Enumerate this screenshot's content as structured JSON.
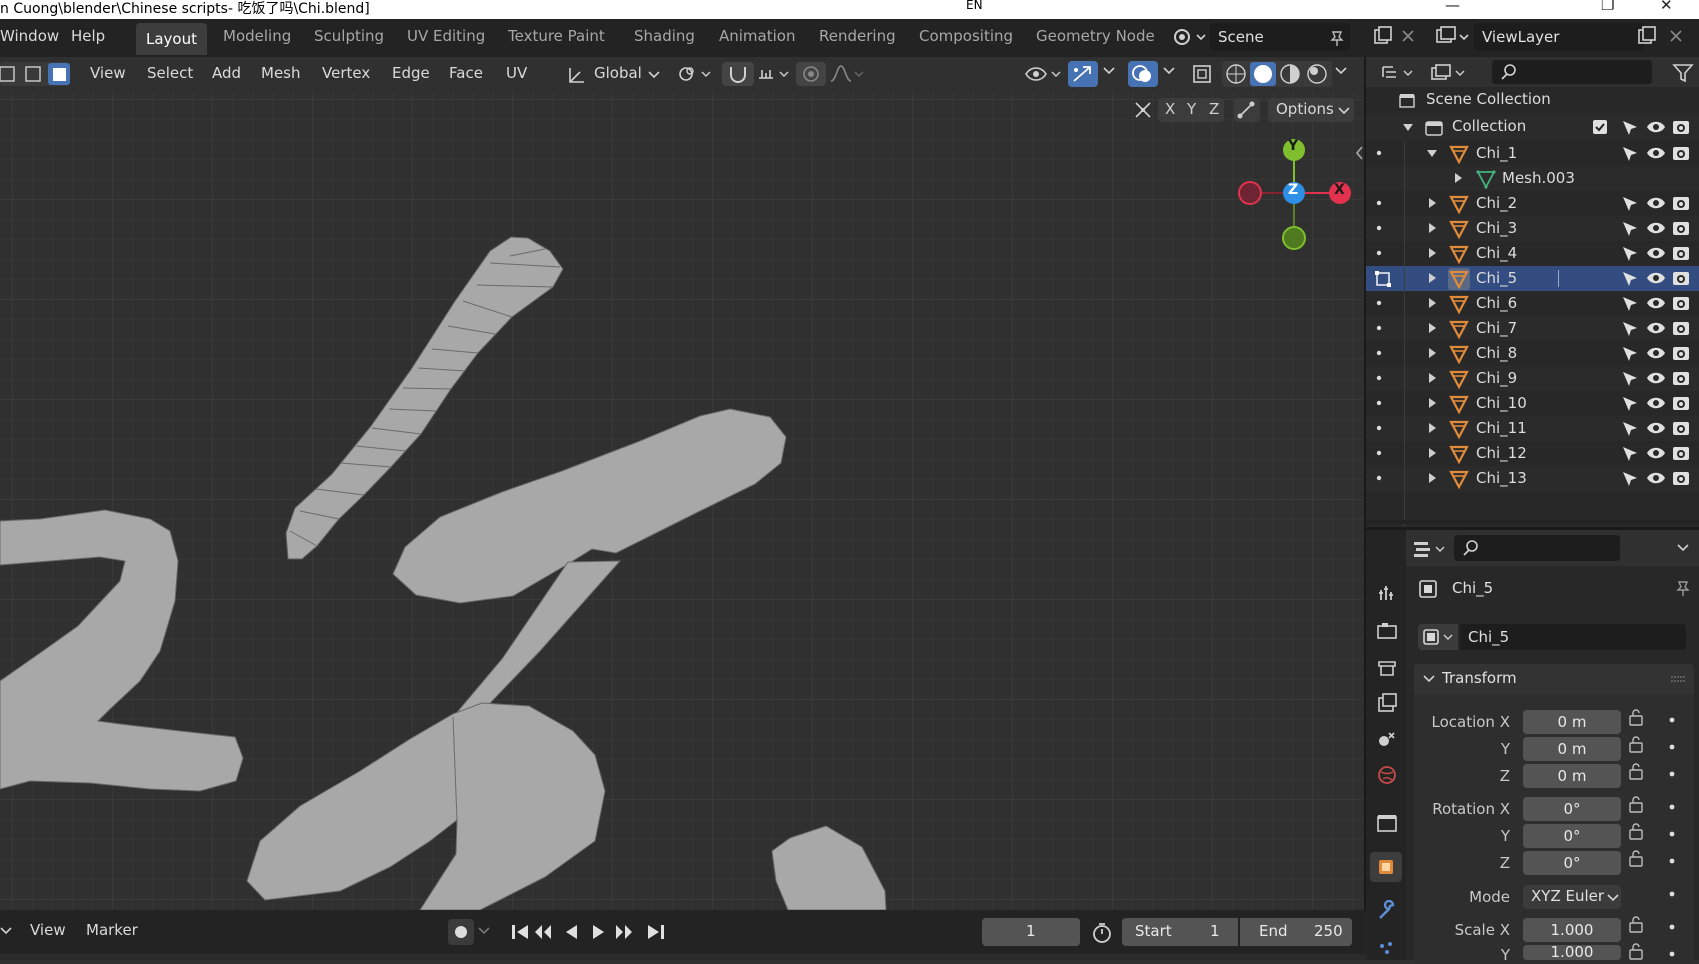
{
  "title_bar": {
    "path": "n Cuong\\blender\\Chinese scripts- 吃饭了吗\\Chi.blend]",
    "lang": "EN",
    "minimize": "—",
    "restore": "❐",
    "close": "✕"
  },
  "menu": {
    "window": "Window",
    "help": "Help"
  },
  "workspaces": [
    "Layout",
    "Modeling",
    "Sculpting",
    "UV Editing",
    "Texture Paint",
    "Shading",
    "Animation",
    "Rendering",
    "Compositing",
    "Geometry Node"
  ],
  "scene": {
    "name": "Scene"
  },
  "view_layer": {
    "name": "ViewLayer"
  },
  "editor_header": {
    "items": [
      "View",
      "Select",
      "Add",
      "Mesh",
      "Vertex",
      "Edge",
      "Face",
      "UV"
    ],
    "transform_orientation": "Global",
    "axes": [
      "X",
      "Y",
      "Z"
    ],
    "options_label": "Options"
  },
  "gizmo": {
    "y": "Y",
    "z": "Z",
    "x": "X"
  },
  "outliner": {
    "root": "Scene Collection",
    "collection": "Collection",
    "items": [
      {
        "name": "Chi_1",
        "level": 1,
        "expanded": true
      },
      {
        "name": "Mesh.003",
        "level": 2,
        "type": "mesh"
      },
      {
        "name": "Chi_2",
        "level": 1
      },
      {
        "name": "Chi_3",
        "level": 1
      },
      {
        "name": "Chi_4",
        "level": 1
      },
      {
        "name": "Chi_5",
        "level": 1,
        "selected": true
      },
      {
        "name": "Chi_6",
        "level": 1
      },
      {
        "name": "Chi_7",
        "level": 1
      },
      {
        "name": "Chi_8",
        "level": 1
      },
      {
        "name": "Chi_9",
        "level": 1
      },
      {
        "name": "Chi_10",
        "level": 1
      },
      {
        "name": "Chi_11",
        "level": 1
      },
      {
        "name": "Chi_12",
        "level": 1
      },
      {
        "name": "Chi_13",
        "level": 1
      }
    ]
  },
  "properties": {
    "object_name": "Chi_5",
    "datablock_name": "Chi_5",
    "panel": "Transform",
    "location": {
      "label": "Location X",
      "x": "0 m",
      "y": "0 m",
      "z": "0 m"
    },
    "rotation": {
      "label": "Rotation X",
      "x": "0°",
      "y": "0°",
      "z": "0°"
    },
    "mode_label": "Mode",
    "mode_value": "XYZ Euler",
    "scale": {
      "label": "Scale X",
      "x": "1.000",
      "y": "1.000"
    },
    "axis_y": "Y",
    "axis_z": "Z"
  },
  "timeline": {
    "view": "View",
    "marker": "Marker",
    "current_frame": "1",
    "start_label": "Start",
    "start": "1",
    "end_label": "End",
    "end": "250"
  },
  "colors": {
    "accent_blue": "#4772b3",
    "selected_row": "#334d80",
    "object_orange": "#e08a3a",
    "mesh_green": "#43b27f",
    "axis_x": "#e2324e",
    "axis_y": "#7fbf2e",
    "axis_z": "#2e8fe6",
    "mesh_fill": "#a8a8a8"
  }
}
